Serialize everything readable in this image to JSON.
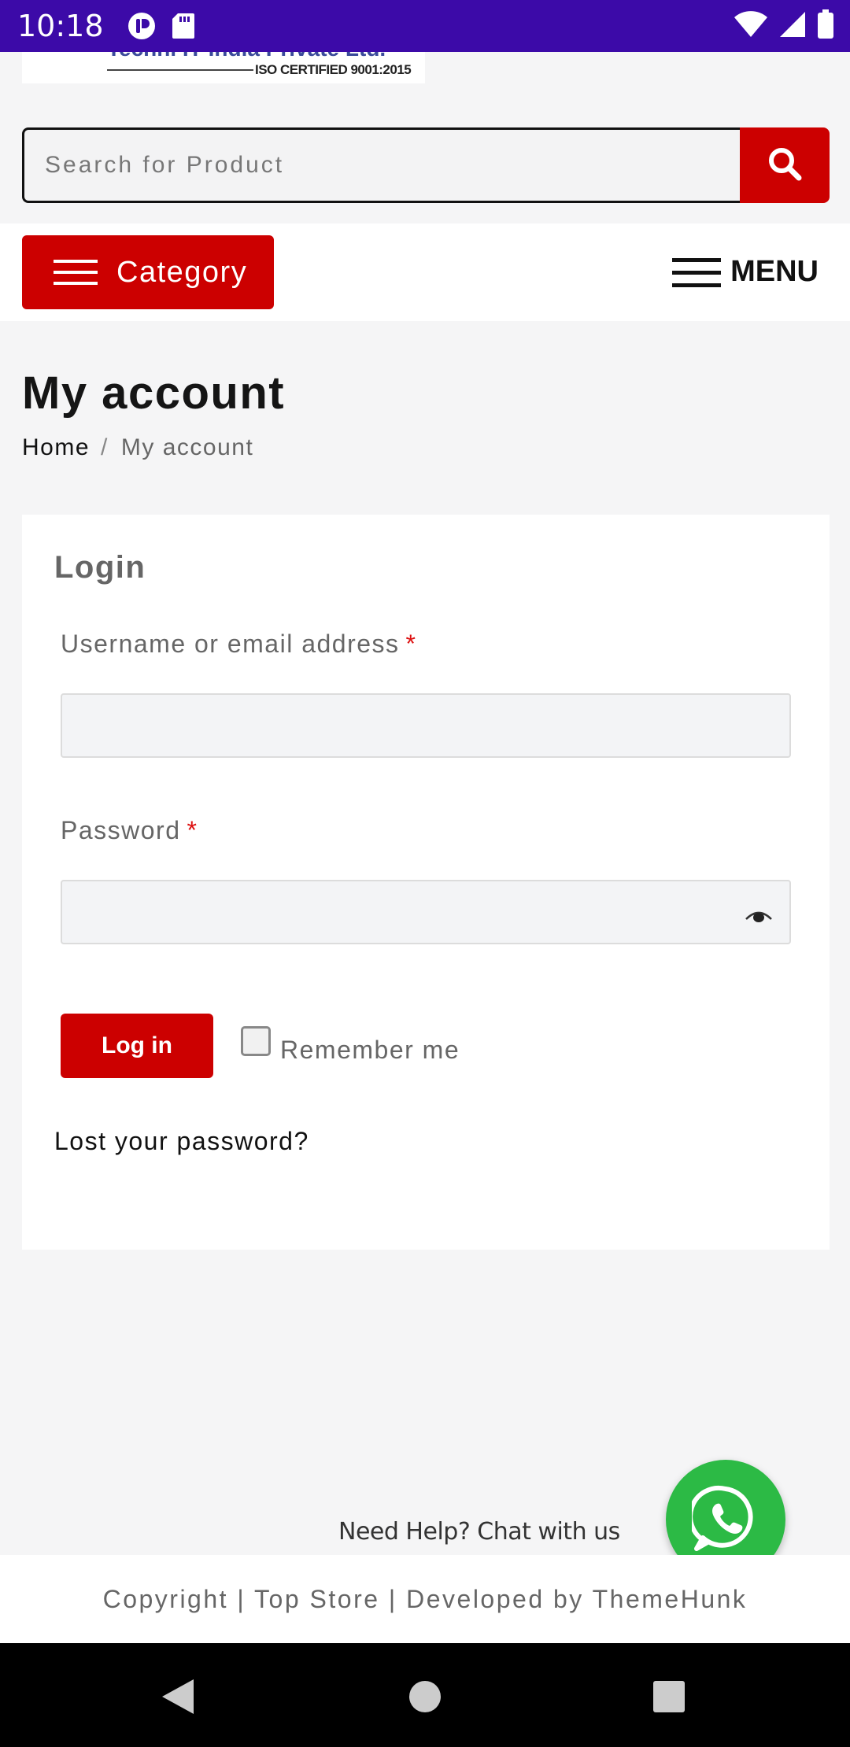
{
  "status_bar": {
    "time": "10:18",
    "icons": [
      "app-notification-icon",
      "sd-card-icon",
      "wifi-icon",
      "signal-icon",
      "battery-icon"
    ]
  },
  "logo": {
    "company_text": "Techni IT India Private Ltd.",
    "certification": "ISO CERTIFIED 9001:2015"
  },
  "search": {
    "placeholder": "Search for Product",
    "icon": "search-icon"
  },
  "nav": {
    "category_label": "Category",
    "menu_label": "MENU"
  },
  "page": {
    "title": "My account",
    "breadcrumb": {
      "home": "Home",
      "separator": "/",
      "current": "My account"
    }
  },
  "login": {
    "title": "Login",
    "username_label": "Username or email address",
    "username_value": "",
    "password_label": "Password",
    "password_value": "",
    "required_mark": "*",
    "submit_label": "Log in",
    "remember_label": "Remember me",
    "remember_checked": false,
    "lost_password_label": "Lost your password?"
  },
  "chat": {
    "label": "Need Help? Chat with us",
    "icon": "whatsapp-icon"
  },
  "footer": {
    "text": "Copyright | Top Store | Developed by ThemeHunk"
  },
  "colors": {
    "status_bar": "#3c0aa8",
    "brand_red": "#cc0000",
    "whatsapp_green": "#2cba45",
    "page_bg": "#f5f5f6"
  }
}
